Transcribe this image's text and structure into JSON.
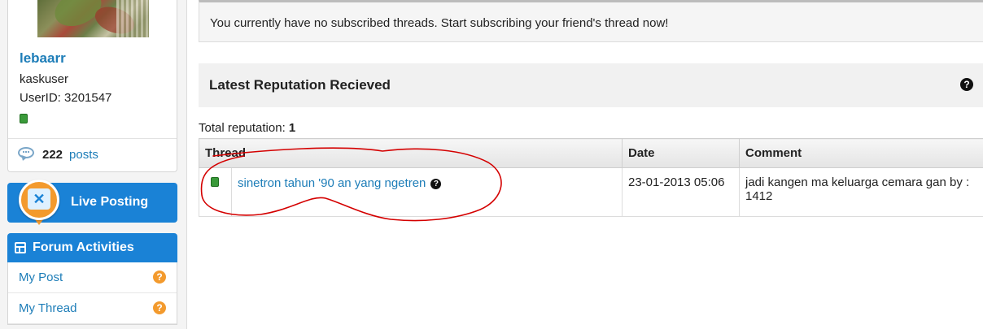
{
  "profile": {
    "username": "lebaarr",
    "usergroup": "kaskuser",
    "userid": "UserID: 3201547",
    "posts_count": "222",
    "posts_label": "posts"
  },
  "sidebar": {
    "live_posting": "Live Posting",
    "live_icon_text": "✕",
    "forum_activities": "Forum Activities",
    "items": [
      {
        "label": "My Post"
      },
      {
        "label": "My Thread"
      }
    ],
    "help_glyph": "?"
  },
  "notice": {
    "text": "You currently have no subscribed threads. Start subscribing your friend's thread now!"
  },
  "reputation": {
    "title": "Latest Reputation Recieved",
    "help_glyph": "?",
    "total_label": "Total reputation: ",
    "total_value": "1",
    "columns": [
      "Thread",
      "Date",
      "Comment"
    ],
    "rows": [
      {
        "thread": "sinetron tahun '90 an yang ngetren",
        "date": "23-01-2013 05:06",
        "comment": "jadi kangen ma keluarga cemara gan by : 1412"
      }
    ]
  },
  "colors": {
    "accent_blue": "#1a82d6",
    "link_blue": "#1d7db8",
    "help_orange": "#f39a2d",
    "online_green": "#3a9a3a",
    "annotation_red": "#d40000"
  }
}
